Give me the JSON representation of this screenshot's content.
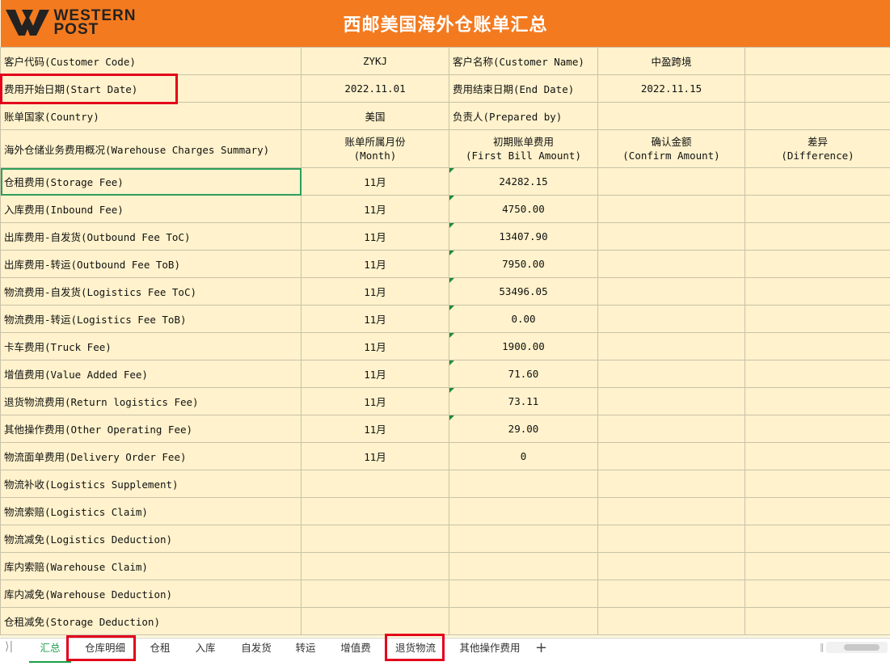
{
  "header": {
    "logo_text_line1": "WESTERN",
    "logo_text_line2": "POST",
    "title": "西邮美国海外仓账单汇总",
    "brand_color": "#f47a1f"
  },
  "info_rows": [
    {
      "label": "客户代码(Customer Code)",
      "value": "ZYKJ",
      "label2": "客户名称(Customer Name)",
      "value2": "中盈跨境"
    },
    {
      "label": "费用开始日期(Start Date)",
      "value": "2022.11.01",
      "label2": "费用结束日期(End Date)",
      "value2": "2022.11.15"
    },
    {
      "label": "账单国家(Country)",
      "value": "美国",
      "label2": "负责人(Prepared by)",
      "value2": ""
    }
  ],
  "summary_header": {
    "label": "海外仓储业务费用概况(Warehouse Charges Summary)",
    "month_cn": "账单所属月份",
    "month_en": "(Month)",
    "first_cn": "初期账单费用",
    "first_en": "(First Bill Amount)",
    "confirm_cn": "确认金额",
    "confirm_en": "(Confirm Amount)",
    "diff_cn": "差异",
    "diff_en": "(Difference)"
  },
  "fees": [
    {
      "name": "仓租费用(Storage Fee)",
      "month": "11月",
      "amount": "24282.15"
    },
    {
      "name": "入库费用(Inbound Fee)",
      "month": "11月",
      "amount": "4750.00"
    },
    {
      "name": "出库费用-自发货(Outbound Fee ToC)",
      "month": "11月",
      "amount": "13407.90"
    },
    {
      "name": "出库费用-转运(Outbound Fee ToB)",
      "month": "11月",
      "amount": "7950.00"
    },
    {
      "name": "物流费用-自发货(Logistics Fee ToC)",
      "month": "11月",
      "amount": "53496.05"
    },
    {
      "name": "物流费用-转运(Logistics Fee ToB)",
      "month": "11月",
      "amount": "0.00"
    },
    {
      "name": "卡车费用(Truck Fee)",
      "month": "11月",
      "amount": "1900.00"
    },
    {
      "name": "增值费用(Value Added Fee)",
      "month": "11月",
      "amount": "71.60"
    },
    {
      "name": "退货物流费用(Return logistics Fee)",
      "month": "11月",
      "amount": "73.11"
    },
    {
      "name": "其他操作费用(Other Operating Fee)",
      "month": "11月",
      "amount": "29.00"
    },
    {
      "name": "物流面单费用(Delivery Order Fee)",
      "month": "11月",
      "amount": "0"
    },
    {
      "name": "物流补收(Logistics Supplement)",
      "month": "",
      "amount": ""
    },
    {
      "name": "物流索赔(Logistics Claim)",
      "month": "",
      "amount": ""
    },
    {
      "name": "物流减免(Logistics Deduction)",
      "month": "",
      "amount": ""
    },
    {
      "name": "库内索赔(Warehouse Claim)",
      "month": "",
      "amount": ""
    },
    {
      "name": "库内减免(Warehouse Deduction)",
      "month": "",
      "amount": ""
    },
    {
      "name": "仓租减免(Storage Deduction)",
      "month": "",
      "amount": ""
    }
  ],
  "tabs": [
    "汇总",
    "仓库明细",
    "仓租",
    "入库",
    "自发货",
    "转运",
    "增值费",
    "退货物流",
    "其他操作费用"
  ],
  "active_tab": "汇总",
  "colors": {
    "cell_bg": "#fff2cc",
    "highlight_box": "#e3001b",
    "selection": "#2e9e5b",
    "active_tab": "#1a9e4a"
  }
}
